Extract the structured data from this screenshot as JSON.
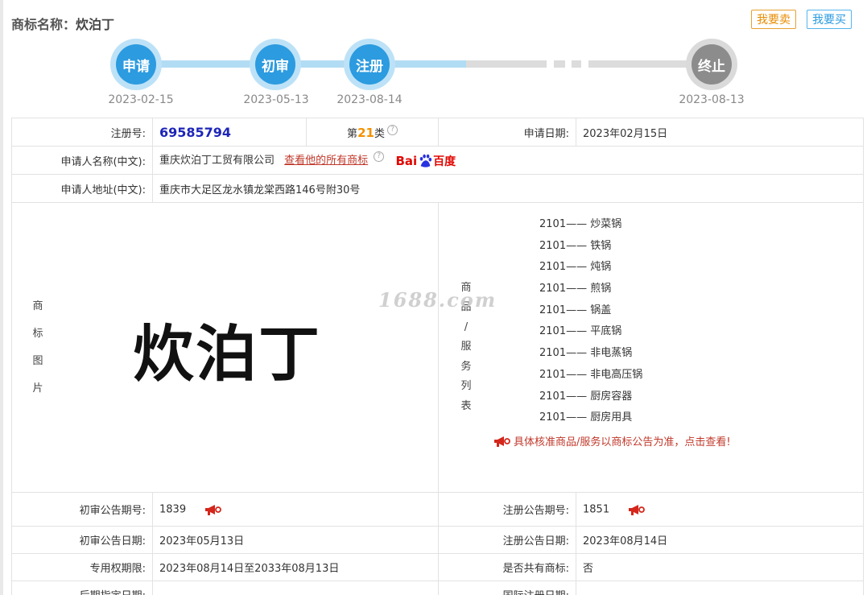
{
  "header": {
    "title_label": "商标名称：",
    "trademark_name": "炊泊丁",
    "sell_button": "我要卖",
    "buy_button": "我要买"
  },
  "timeline": {
    "steps": [
      {
        "label": "申请",
        "date": "2023-02-15",
        "status": "done"
      },
      {
        "label": "初审",
        "date": "2023-05-13",
        "status": "done"
      },
      {
        "label": "注册",
        "date": "2023-08-14",
        "status": "done"
      },
      {
        "label": "终止",
        "date": "2023-08-13",
        "status": "pending"
      }
    ]
  },
  "details": {
    "reg_no_label": "注册号:",
    "reg_no": "69585794",
    "class_prefix": "第",
    "class_num": "21",
    "class_suffix": "类",
    "apply_date_label": "申请日期:",
    "apply_date": "2023年02月15日",
    "applicant_label": "申请人名称(中文):",
    "applicant": "重庆炊泊丁工贸有限公司",
    "all_marks_link": "查看他的所有商标",
    "baidu_text1": "Bai",
    "baidu_text2": "百度",
    "address_label": "申请人地址(中文):",
    "address": "重庆市大足区龙水镇龙棠西路146号附30号",
    "mark_image_label": [
      "商",
      "标",
      "图",
      "片"
    ],
    "mark_image_text": "炊泊丁",
    "goods_label": [
      "商",
      "品",
      "/",
      "服",
      "务",
      "列",
      "表"
    ],
    "goods": [
      {
        "code": "2101",
        "name": "炒菜锅"
      },
      {
        "code": "2101",
        "name": "铁锅"
      },
      {
        "code": "2101",
        "name": "炖锅"
      },
      {
        "code": "2101",
        "name": "煎锅"
      },
      {
        "code": "2101",
        "name": "锅盖"
      },
      {
        "code": "2101",
        "name": "平底锅"
      },
      {
        "code": "2101",
        "name": "非电蒸锅"
      },
      {
        "code": "2101",
        "name": "非电高压锅"
      },
      {
        "code": "2101",
        "name": "厨房容器"
      },
      {
        "code": "2101",
        "name": "厨房用具"
      }
    ],
    "goods_separator": "——",
    "watermark": "1688.com",
    "notice": "具体核准商品/服务以商标公告为准，点击查看!",
    "prelim_no_label": "初审公告期号:",
    "prelim_no": "1839",
    "reg_pub_no_label": "注册公告期号:",
    "reg_pub_no": "1851",
    "prelim_date_label": "初审公告日期:",
    "prelim_date": "2023年05月13日",
    "reg_pub_date_label": "注册公告日期:",
    "reg_pub_date": "2023年08月14日",
    "exclusive_label": "专用权期限:",
    "exclusive": "2023年08月14日至2033年08月13日",
    "shared_label": "是否共有商标:",
    "shared": "否",
    "late_date_label": "后期指定日期:",
    "intl_date_label": "国际注册日期:"
  },
  "colors": {
    "accent_blue": "#2c9be0",
    "reg_no_blue": "#1d25b8",
    "class_orange": "#f29100",
    "link_red": "#c0392b"
  }
}
